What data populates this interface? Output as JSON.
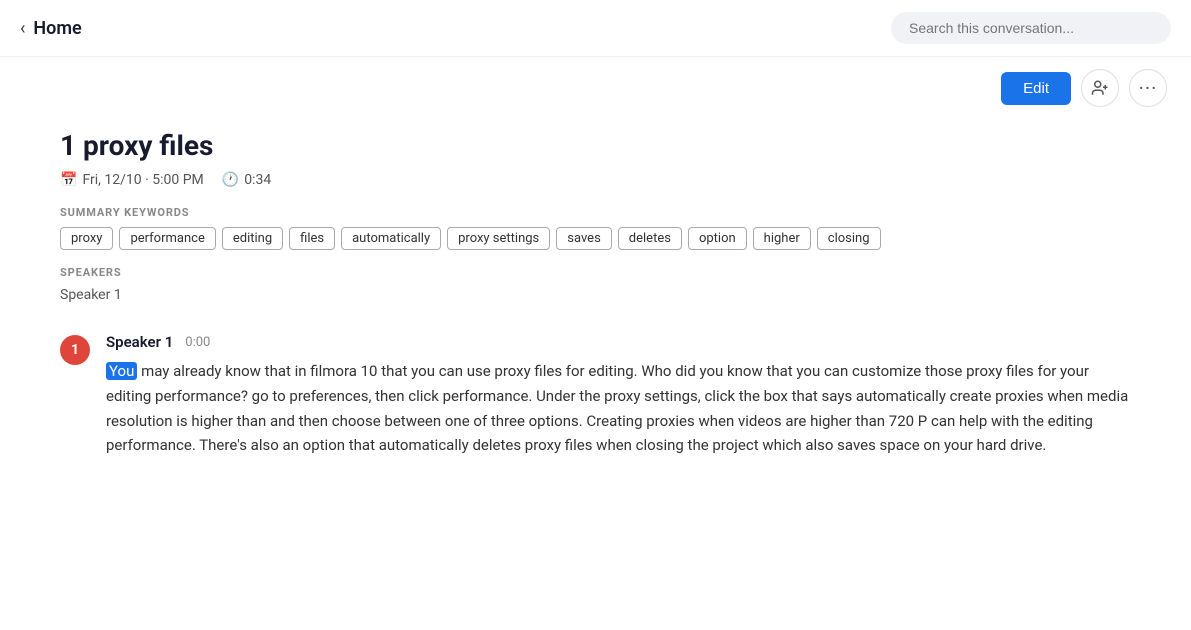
{
  "nav": {
    "back_label": "‹",
    "home_label": "Home",
    "search_placeholder": "Search this conversation..."
  },
  "actions": {
    "edit_label": "Edit",
    "add_person_icon": "add-person",
    "more_icon": "more"
  },
  "conversation": {
    "title": "1 proxy files",
    "date": "Fri, 12/10 · 5:00 PM",
    "duration": "0:34"
  },
  "summary": {
    "label": "SUMMARY KEYWORDS",
    "keywords": [
      "proxy",
      "performance",
      "editing",
      "files",
      "automatically",
      "proxy settings",
      "saves",
      "deletes",
      "option",
      "higher",
      "closing"
    ]
  },
  "speakers_section": {
    "label": "SPEAKERS",
    "speakers": [
      "Speaker 1"
    ]
  },
  "transcript": [
    {
      "badge_number": "1",
      "speaker": "Speaker 1",
      "timestamp": "0:00",
      "highlighted_word": "You",
      "text": " may already know that in filmora 10 that you can use proxy files for editing. Who did you know that you can customize those proxy files for your editing performance? go to preferences, then click performance. Under the proxy settings, click the box that says automatically create proxies when media resolution is higher than and then choose between one of three options. Creating proxies when videos are higher than 720 P can help with the editing performance. There's also an option that automatically deletes proxy files when closing the project which also saves space on your hard drive."
    }
  ]
}
